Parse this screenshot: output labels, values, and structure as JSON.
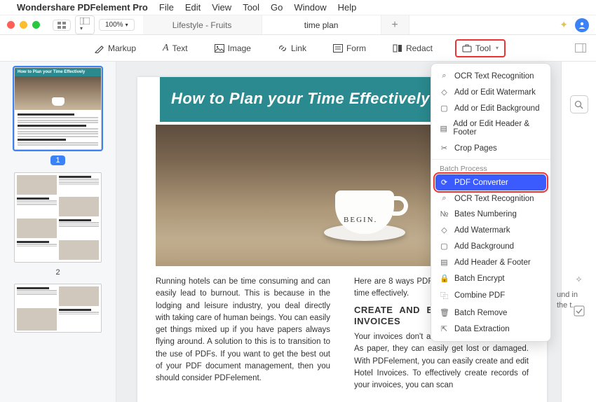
{
  "menubar": {
    "app": "Wondershare PDFelement Pro",
    "items": [
      "File",
      "Edit",
      "View",
      "Tool",
      "Go",
      "Window",
      "Help"
    ]
  },
  "titlebar": {
    "zoom": "100%",
    "tabs": [
      {
        "label": "Lifestyle - Fruits",
        "active": false
      },
      {
        "label": "time plan",
        "active": true
      }
    ]
  },
  "toolbar": {
    "markup": "Markup",
    "text": "Text",
    "image": "Image",
    "link": "Link",
    "form": "Form",
    "redact": "Redact",
    "tool": "Tool"
  },
  "thumbs": {
    "doc_title": "How to Plan your Time Effectively",
    "page1_badge": "1",
    "page2_num": "2"
  },
  "document": {
    "title": "How to Plan your Time Effectively",
    "cup_label": "BEGIN.",
    "col1": "Running hotels can be time consuming and can easily lead to burnout. This is because in the lodging and leisure industry, you deal directly with taking care of human beings. You can easily get things mixed up if you have papers always flying around. A solution to this is to transition to the use of PDFs. If you want to get the best out of your PDF document management, then you should consider PDFelement.",
    "col2_lead": "Here are 8 ways PDFelement lets you plan your time effectively.",
    "col2_h": "CREATE AND EASILY EDIT HOTEL INVOICES",
    "col2_body": "Your invoices don't always have to be in paper. As paper, they can easily get lost or damaged. With PDFelement, you can easily create and edit Hotel Invoices. To effectively create records of your invoices, you can scan"
  },
  "dropdown": {
    "section1": [
      {
        "icon": "ocr",
        "label": "OCR Text Recognition"
      },
      {
        "icon": "watermark",
        "label": "Add or Edit Watermark"
      },
      {
        "icon": "background",
        "label": "Add or Edit Background"
      },
      {
        "icon": "header",
        "label": "Add or Edit Header & Footer"
      },
      {
        "icon": "crop",
        "label": "Crop Pages"
      }
    ],
    "batch_head": "Batch Process",
    "selected": {
      "icon": "convert",
      "label": "PDF Converter"
    },
    "section2": [
      {
        "icon": "ocr",
        "label": "OCR Text Recognition"
      },
      {
        "icon": "bates",
        "label": "Bates Numbering"
      },
      {
        "icon": "watermark",
        "label": "Add Watermark"
      },
      {
        "icon": "background",
        "label": "Add Background"
      },
      {
        "icon": "header",
        "label": "Add Header & Footer"
      },
      {
        "icon": "encrypt",
        "label": "Batch Encrypt"
      },
      {
        "icon": "combine",
        "label": "Combine PDF"
      },
      {
        "icon": "remove",
        "label": "Batch Remove"
      },
      {
        "icon": "extract",
        "label": "Data Extraction"
      }
    ]
  },
  "rightpane_hint": "und in the t."
}
